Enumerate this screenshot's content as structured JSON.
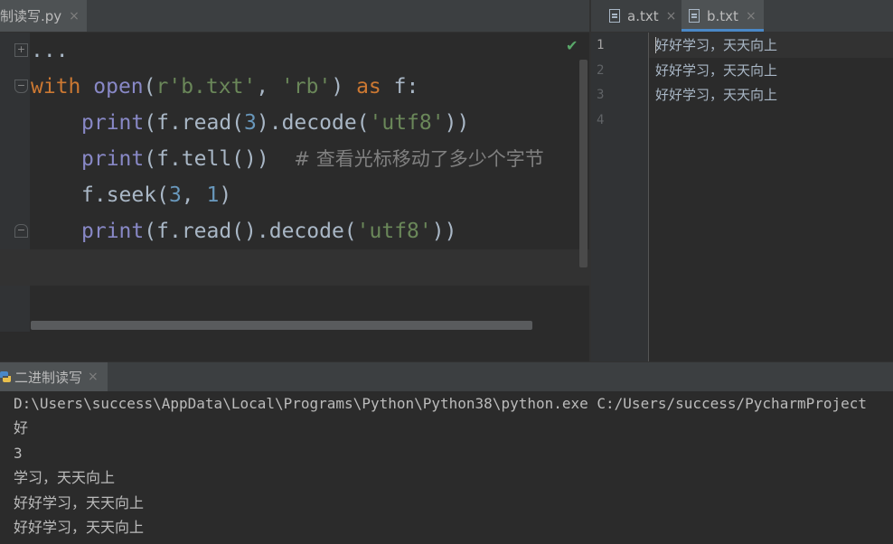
{
  "left_tab": {
    "label": "制读写.py",
    "close": "×"
  },
  "right_tabs": [
    {
      "label": "a.txt",
      "close": "×"
    },
    {
      "label": "b.txt",
      "close": "×"
    }
  ],
  "code": {
    "folded": "...",
    "line1": {
      "kw_with": "with",
      "fn_open": "open",
      "p1": "(",
      "str1": "r'b.txt'",
      "p2": ", ",
      "str2": "'rb'",
      "p3": ") ",
      "kw_as": "as",
      "p4": " f:"
    },
    "line2": {
      "fn_print": "print",
      "p1": "(f.read(",
      "num": "3",
      "p2": ").decode(",
      "str": "'utf8'",
      "p3": "))"
    },
    "line3": {
      "fn_print": "print",
      "p1": "(f.tell())  ",
      "comment": "# 查看光标移动了多少个字节"
    },
    "line4": {
      "p1": "f.seek(",
      "num1": "3",
      "p2": ", ",
      "num2": "1",
      "p3": ")"
    },
    "line5": {
      "fn_print": "print",
      "p1": "(f.read().decode(",
      "str": "'utf8'",
      "p2": "))"
    }
  },
  "right_editor": {
    "line_numbers": [
      "1",
      "2",
      "3",
      "4"
    ],
    "lines": [
      "好好学习，天天向上",
      "好好学习，天天向上",
      "好好学习，天天向上"
    ]
  },
  "run": {
    "tab_label": "二进制读写",
    "close": "×",
    "output": [
      "D:\\Users\\success\\AppData\\Local\\Programs\\Python\\Python38\\python.exe C:/Users/success/PycharmProject",
      "好",
      "3",
      "学习，天天向上",
      "好好学习，天天向上",
      "好好学习，天天向上"
    ]
  },
  "colors": {
    "keyword": "#cc7832",
    "builtin": "#8888c6",
    "string": "#6a8759",
    "number": "#6897bb",
    "comment": "#808080",
    "accent": "#4a88c7"
  },
  "icons": {
    "ok": "check-icon",
    "file": "file-icon",
    "run": "python-icon"
  }
}
